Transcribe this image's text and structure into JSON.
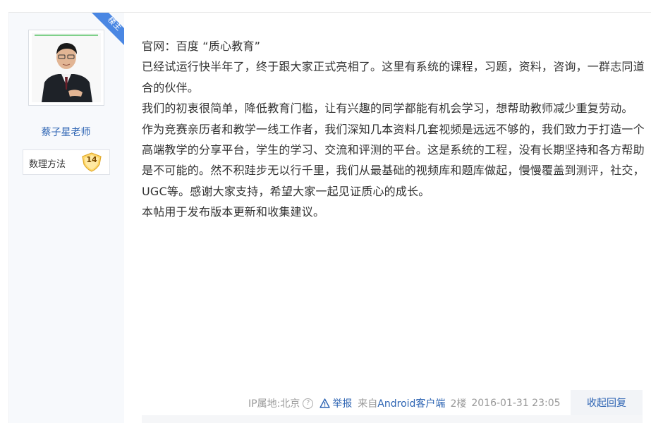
{
  "badge": {
    "text": "楼主",
    "color": "#4a87e3"
  },
  "author": {
    "name": "蔡子星老师",
    "level_name": "数理方法",
    "level": "14"
  },
  "post": {
    "paragraphs": [
      "官网：百度 “质心教育”",
      "已经试运行快半年了，终于跟大家正式亮相了。这里有系统的课程，习题，资料，咨询，一群志同道合的伙伴。",
      "我们的初衷很简单，降低教育门槛，让有兴趣的同学都能有机会学习，想帮助教师减少重复劳动。",
      "作为竞赛亲历者和教学一线工作者，我们深知几本资料几套视频是远远不够的，我们致力于打造一个高端教学的分享平台，学生的学习、交流和评测的平台。这是系统的工程，没有长期坚持和各方帮助是不可能的。然不积跬步无以行千里，我们从最基础的视频库和题库做起，慢慢覆盖到测评，社交，UGC等。感谢大家支持，希望大家一起见证质心的成长。",
      "本帖用于发布版本更新和收集建议。"
    ]
  },
  "tail": {
    "ip_label": "IP属地:北京",
    "help_icon": "question-circle-icon",
    "report_label": "举报",
    "report_icon": "warning-triangle-icon",
    "client_prefix": "来自",
    "client_link": "Android客户端",
    "floor": "2楼",
    "datetime": "2016-01-31 23:05",
    "reply_label": "收起回复"
  }
}
